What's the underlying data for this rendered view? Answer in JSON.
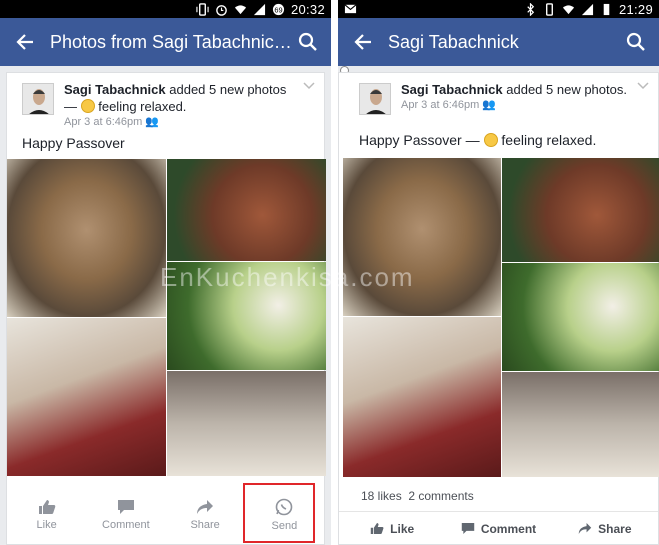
{
  "left": {
    "status": {
      "time": "20:32"
    },
    "appbar": {
      "title": "Photos from Sagi Tabachnic…"
    },
    "post": {
      "author": "Sagi Tabachnick",
      "action": " added 5 new photos — ",
      "feeling": " feeling relaxed.",
      "date": "Apr 3 at 6:46pm",
      "caption": "Happy Passover"
    },
    "actions": [
      {
        "label": "Like",
        "icon": "thumbs-up-icon"
      },
      {
        "label": "Comment",
        "icon": "comment-icon"
      },
      {
        "label": "Share",
        "icon": "share-icon"
      },
      {
        "label": "Send",
        "icon": "whatsapp-icon"
      }
    ]
  },
  "right": {
    "status": {
      "time": "21:29"
    },
    "appbar": {
      "title": "Sagi Tabachnick"
    },
    "post": {
      "author": "Sagi Tabachnick",
      "action": " added 5 new photos.",
      "date": "Apr 3 at 6:46pm",
      "caption": "Happy Passover — ",
      "feeling": " feeling relaxed."
    },
    "stats": {
      "likes": "18 likes",
      "comments": "2 comments"
    },
    "actions": [
      {
        "label": "Like",
        "icon": "thumbs-up-icon"
      },
      {
        "label": "Comment",
        "icon": "comment-icon"
      },
      {
        "label": "Share",
        "icon": "share-icon"
      }
    ]
  },
  "watermark": "EnKuchenkisa.com",
  "colors": {
    "facebook_blue": "#3b5998",
    "highlight": "#e0262a",
    "whatsapp": "#25d366"
  }
}
